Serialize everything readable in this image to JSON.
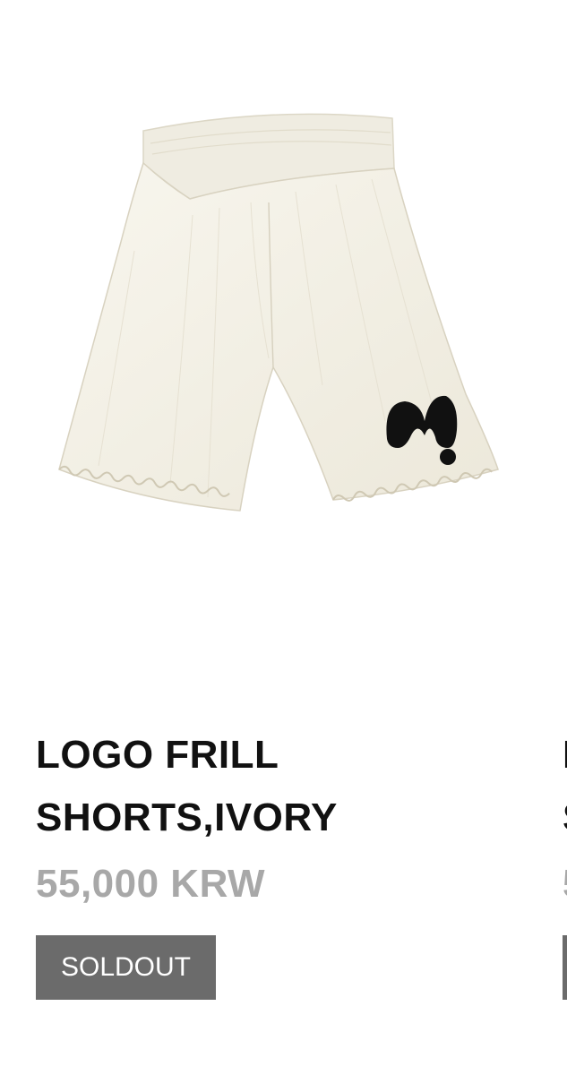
{
  "products": [
    {
      "title_line1": "LOGO FRILL",
      "title_line2": "SHORTS,IVORY",
      "price": "55,000 KRW",
      "status_button": "SOLDOUT",
      "image_name": "ivory-frill-shorts-photo"
    },
    {
      "title_line1": "L",
      "title_line2": "S",
      "price": "5",
      "status_button": ""
    }
  ],
  "colors": {
    "title": "#111111",
    "price": "#a8a8a8",
    "soldout_bg": "#6b6b6b",
    "soldout_text": "#ffffff",
    "shorts_fabric": "#f6f3e8",
    "logo": "#111111"
  }
}
